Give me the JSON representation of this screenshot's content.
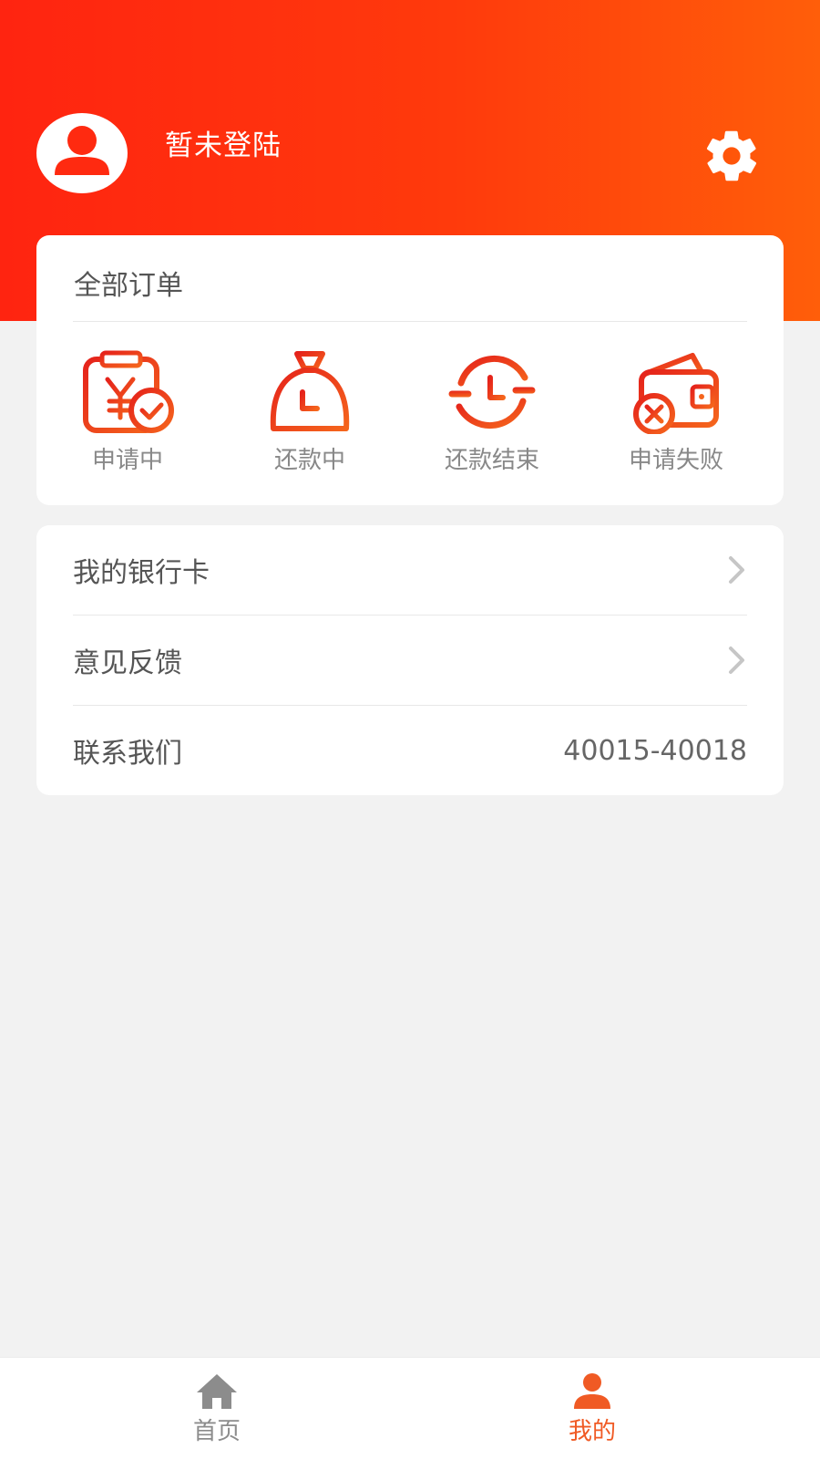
{
  "header": {
    "login_status": "暂未登陆"
  },
  "orders": {
    "title": "全部订单",
    "items": [
      {
        "label": "申请中",
        "icon": "applying-icon"
      },
      {
        "label": "还款中",
        "icon": "money-bag-clock-icon"
      },
      {
        "label": "还款结束",
        "icon": "clock-refresh-icon"
      },
      {
        "label": "申请失败",
        "icon": "wallet-failed-icon"
      }
    ]
  },
  "menu": {
    "bank_card": "我的银行卡",
    "feedback": "意见反馈",
    "contact": "联系我们",
    "contact_phone": "40015-40018"
  },
  "tabbar": {
    "home": "首页",
    "mine": "我的"
  },
  "colors": {
    "accent": "#ff3a0c",
    "icon_gradient_start": "#e5221b",
    "icon_gradient_end": "#f5651c",
    "tab_active": "#f05a24",
    "tab_inactive": "#8c8c8c"
  }
}
